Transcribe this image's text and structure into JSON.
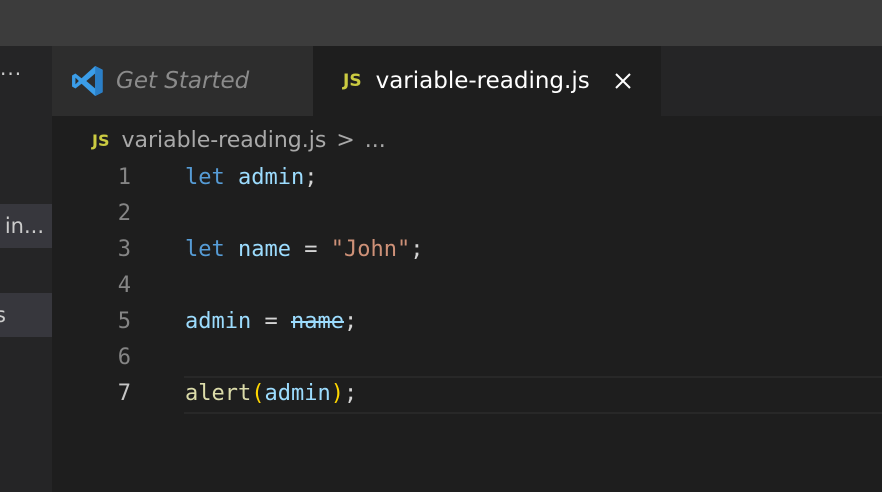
{
  "sidebar": {
    "more_label": "···",
    "rows": [
      {
        "label": "in..."
      },
      {
        "label": "s"
      }
    ]
  },
  "tabs": [
    {
      "label": "Get Started",
      "icon": "vscode-logo-icon",
      "active": false
    },
    {
      "label": "variable-reading.js",
      "badge": "JS",
      "active": true
    }
  ],
  "breadcrumb": {
    "badge": "JS",
    "file": "variable-reading.js",
    "separator": ">",
    "tail": "..."
  },
  "editor": {
    "current_line": 7,
    "lines": [
      {
        "num": "1",
        "tokens": [
          [
            "kw",
            "let"
          ],
          [
            "op",
            " "
          ],
          [
            "var",
            "admin"
          ],
          [
            "op",
            ";"
          ]
        ]
      },
      {
        "num": "2",
        "tokens": []
      },
      {
        "num": "3",
        "tokens": [
          [
            "kw",
            "let"
          ],
          [
            "op",
            " "
          ],
          [
            "var",
            "name"
          ],
          [
            "op",
            " = "
          ],
          [
            "str",
            "\"John\""
          ],
          [
            "op",
            ";"
          ]
        ]
      },
      {
        "num": "4",
        "tokens": []
      },
      {
        "num": "5",
        "tokens": [
          [
            "var",
            "admin"
          ],
          [
            "op",
            " = "
          ],
          [
            "deprecated",
            "name"
          ],
          [
            "op",
            ";"
          ]
        ]
      },
      {
        "num": "6",
        "tokens": []
      },
      {
        "num": "7",
        "tokens": [
          [
            "fn",
            "alert"
          ],
          [
            "paren",
            "("
          ],
          [
            "var",
            "admin"
          ],
          [
            "paren",
            ")"
          ],
          [
            "op",
            ";"
          ]
        ]
      }
    ]
  },
  "colors": {
    "keyword": "#569cd6",
    "variable": "#9cdcfe",
    "string": "#ce9178",
    "function": "#dcdcaa",
    "bracket": "#ffd700",
    "js_badge": "#cbcb41",
    "vscode_blue": "#3b9de8"
  }
}
